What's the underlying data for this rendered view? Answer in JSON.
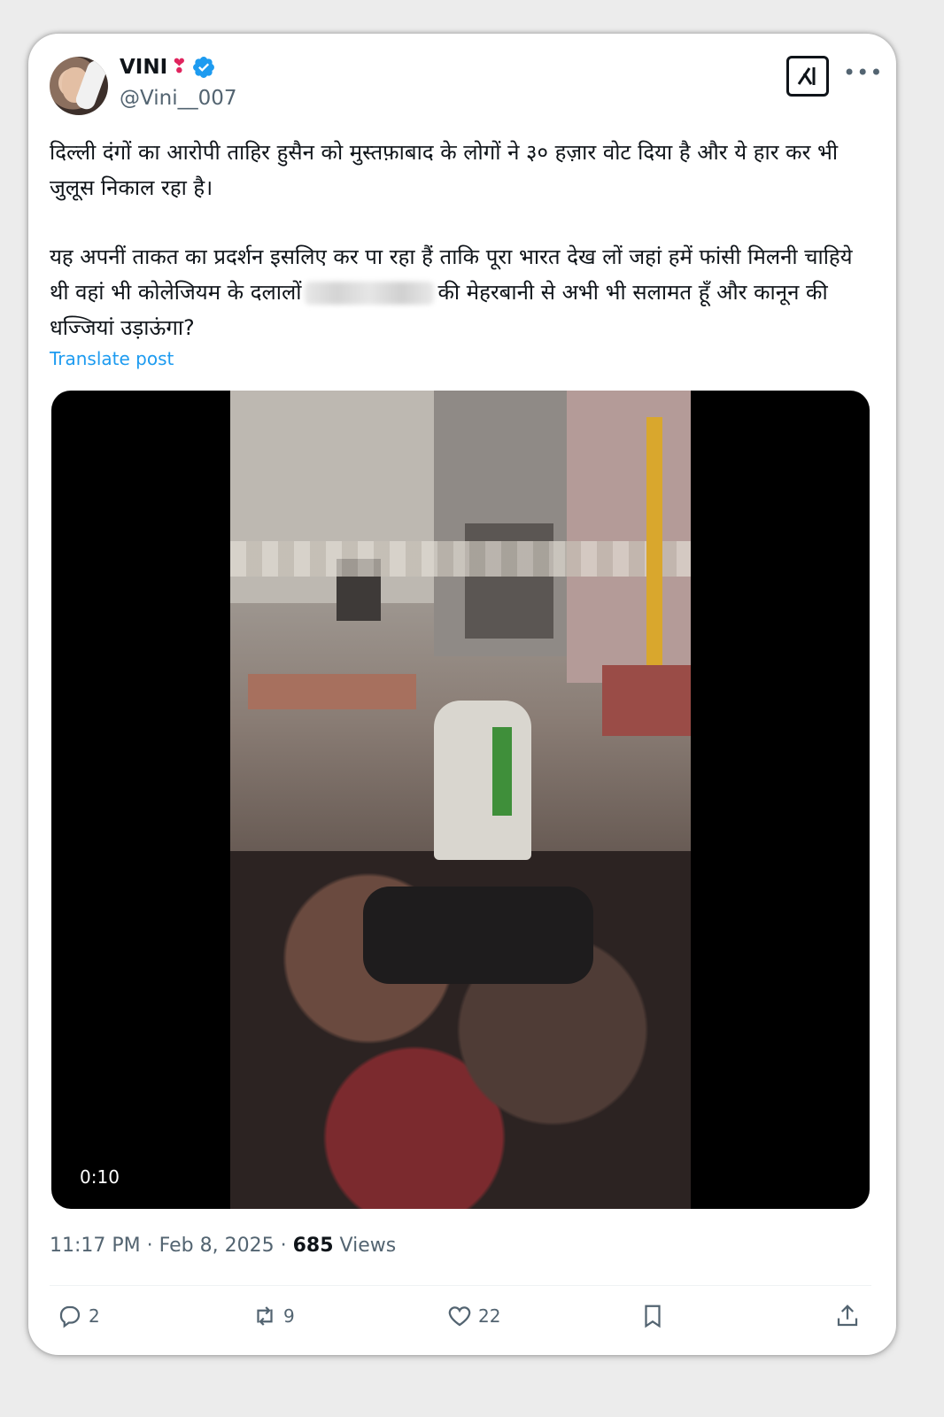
{
  "author": {
    "name": "VINI",
    "handle": "@Vini__007"
  },
  "tweet": {
    "para1": "दिल्ली दंगों का आरोपी ताहिर हुसैन को मुस्तफ़ाबाद के लोगों ने ३० हज़ार वोट दिया है और ये हार कर भी जुलूस निकाल रहा है।",
    "para2_part1": "यह अपनीं ताकत का प्रदर्शन इसलिए कर पा रहा हैं ताकि पूरा भारत देख लों जहां हमें फांसी मिलनी चाहिये थी वहां भी कोलेजियम के दलालों",
    "para2_part2": "की मेहरबानी से अभी भी सलामत हूँ और कानून की धज्जियां उड़ाऊंगा?",
    "translate_label": "Translate post"
  },
  "media": {
    "duration": "0:10"
  },
  "meta": {
    "time": "11:17 PM",
    "date": "Feb 8, 2025",
    "views_count": "685",
    "views_label": "Views"
  },
  "actions": {
    "replies": "2",
    "reposts": "9",
    "likes": "22"
  },
  "colors": {
    "accent": "#1d9bf0",
    "muted": "#536471",
    "text": "#0f1419"
  }
}
